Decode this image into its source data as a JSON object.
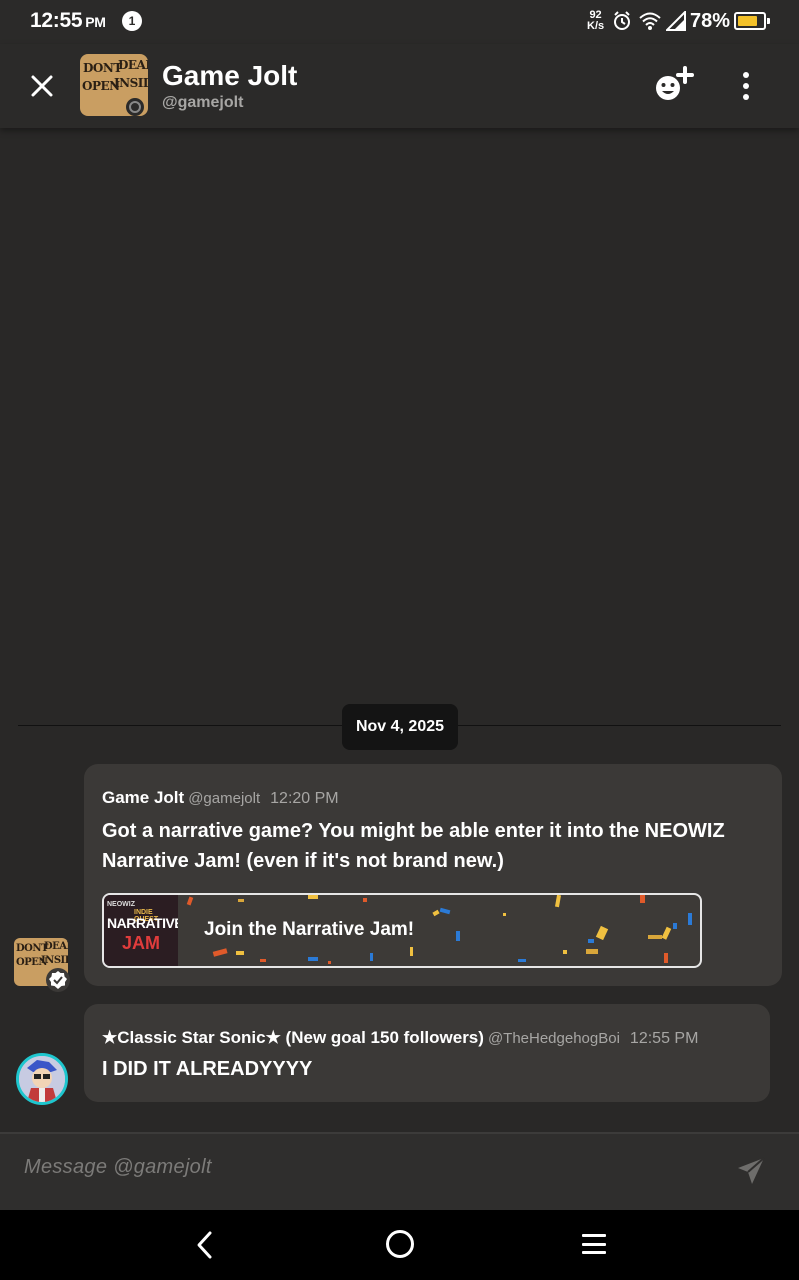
{
  "status_bar": {
    "time": "12:55",
    "ampm": "PM",
    "notification_count": "1",
    "net_speed_value": "92",
    "net_speed_unit": "K/s",
    "battery_percent": "78%",
    "battery_level": 0.78,
    "icons": [
      "alarm-icon",
      "wifi-icon",
      "signal-icon",
      "battery-icon"
    ]
  },
  "header": {
    "title": "Game Jolt",
    "handle": "@gamejolt",
    "avatar_text": [
      "DONT",
      "DEAD",
      "OPEN",
      "INSIDE"
    ],
    "actions": [
      "close-icon",
      "add-friend-icon",
      "more-vertical-icon"
    ]
  },
  "chat": {
    "date_separator": "Nov 4, 2025",
    "messages": [
      {
        "author": "Game Jolt",
        "handle": "@gamejolt",
        "time": "12:20 PM",
        "text": "Got a narrative game? You might be able enter it into the NEOWIZ Narrative Jam! (even if it's not brand new.)",
        "verified": true,
        "link_card": {
          "label": "Join the Narrative Jam!",
          "thumb_brand": "NEOWIZ",
          "thumb_sub": "INDIE QUEST",
          "thumb_title": "NARRATIVE",
          "thumb_title2": "JAM"
        }
      },
      {
        "author": "★Classic Star Sonic★ (New goal 150 followers)",
        "handle": "@TheHedgehogBoi",
        "time": "12:55 PM",
        "text": "I DID IT ALREADYYYY"
      }
    ]
  },
  "composer": {
    "placeholder": "Message @gamejolt",
    "send_icon": "send-icon"
  },
  "nav_bar": {
    "buttons": [
      "back-icon",
      "home-icon",
      "recents-icon"
    ]
  },
  "colors": {
    "background": "#292827",
    "bubble": "#3b3937",
    "battery_fill": "#f3c12a",
    "reply_avatar_ring": "#1ec6ce",
    "muted_text": "#a7a6a4"
  }
}
